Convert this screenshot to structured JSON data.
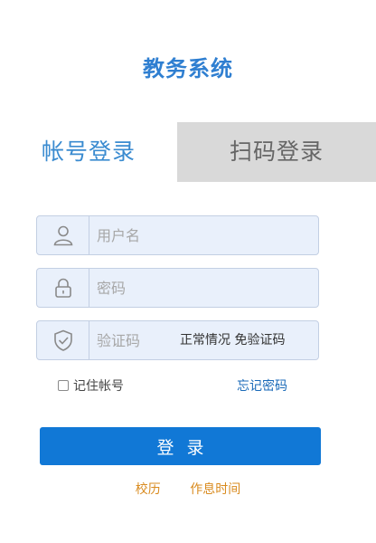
{
  "header": {
    "title": "教务系统"
  },
  "tabs": [
    {
      "label": "帐号登录",
      "active": true
    },
    {
      "label": "扫码登录",
      "active": false
    }
  ],
  "form": {
    "username": {
      "placeholder": "用户名",
      "value": "",
      "icon": "user-icon"
    },
    "password": {
      "placeholder": "密码",
      "value": "",
      "icon": "lock-icon"
    },
    "captcha": {
      "placeholder": "验证码",
      "value": "",
      "icon": "shield-icon",
      "note": "正常情况 免验证码"
    },
    "remember_label": "记住帐号",
    "remember_checked": false,
    "forgot_label": "忘记密码",
    "submit_label": "登录"
  },
  "footer": {
    "links": [
      {
        "label": "校历"
      },
      {
        "label": "作息时间"
      }
    ]
  },
  "colors": {
    "title": "#2f7fd1",
    "active_tab_text": "#3a8bd0",
    "inactive_tab_bg": "#d9d9d9",
    "field_bg": "#e9f0fb",
    "button_bg": "#1178d6",
    "link_blue": "#1a6ab8",
    "footer_link": "#d98b1f"
  }
}
